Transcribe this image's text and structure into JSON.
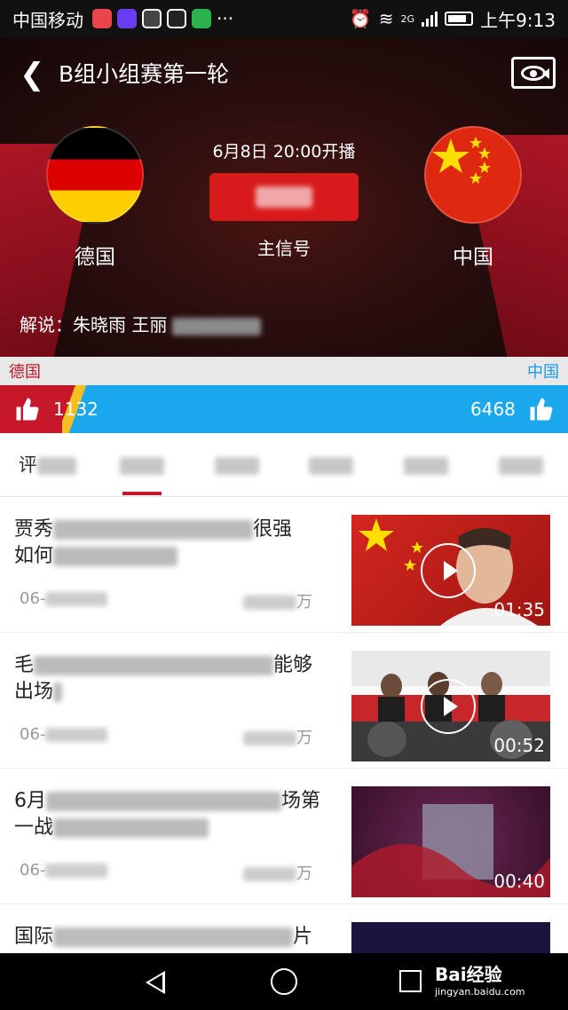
{
  "status_bar": {
    "carrier": "中国移动",
    "network": "2G",
    "time": "上午9:13"
  },
  "header": {
    "title": "B组小组赛第一轮",
    "home_team": "德国",
    "away_team": "中国",
    "broadcast_time": "6月8日 20:00开播",
    "signal": "主信号",
    "commentary": "解说：朱晓雨 王丽"
  },
  "vote": {
    "home_label": "德国",
    "away_label": "中国",
    "home_count": "1132",
    "away_count": "6468",
    "colors": {
      "home": "#c7172a",
      "away": "#1aa7ec"
    }
  },
  "tabs": [
    {
      "label": "评"
    },
    {
      "label": ""
    },
    {
      "label": ""
    },
    {
      "label": ""
    },
    {
      "label": ""
    },
    {
      "label": ""
    }
  ],
  "news": [
    {
      "headline": "贾秀  很强\n如何",
      "date": "06-",
      "views": "万",
      "duration": "01:35"
    },
    {
      "headline": "毛             能够\n出场",
      "date": "06-",
      "views": "万",
      "duration": "00:52"
    },
    {
      "headline": "6月              场第\n一战",
      "date": "06-",
      "views": "万",
      "duration": "00:40"
    },
    {
      "headline": "国际                片",
      "date": "",
      "views": "",
      "duration": ""
    }
  ],
  "watermark": {
    "brand": "Bai经验",
    "url": "jingyan.baidu.com"
  }
}
